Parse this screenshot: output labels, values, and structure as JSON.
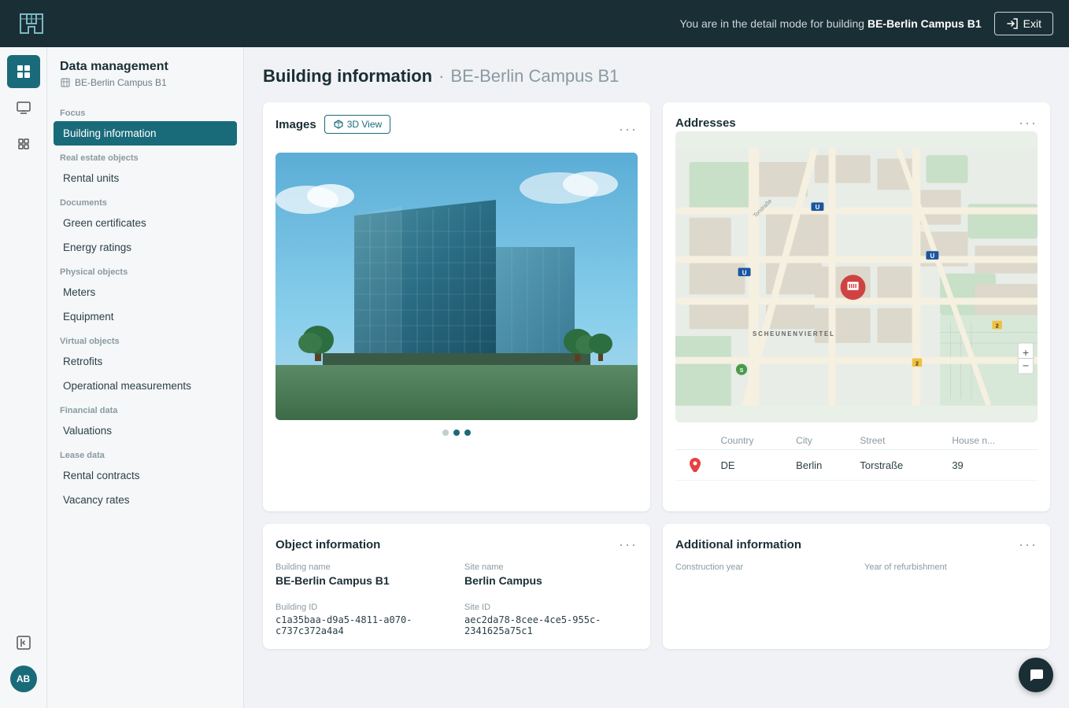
{
  "topbar": {
    "mode_text": "You are in the detail mode for building ",
    "building_name": "BE-Berlin Campus B1",
    "exit_label": "Exit"
  },
  "sidebar": {
    "title": "Data management",
    "subtitle": "BE-Berlin Campus B1",
    "focus_label": "Focus",
    "nav_items": [
      {
        "id": "building-information",
        "label": "Building information",
        "active": true,
        "section": null
      },
      {
        "id": "rental-units",
        "label": "Rental units",
        "active": false,
        "section": "Real estate objects"
      },
      {
        "id": "green-certificates",
        "label": "Green certificates",
        "active": false,
        "section": "Documents"
      },
      {
        "id": "energy-ratings",
        "label": "Energy ratings",
        "active": false,
        "section": null
      },
      {
        "id": "meters",
        "label": "Meters",
        "active": false,
        "section": "Physical objects"
      },
      {
        "id": "equipment",
        "label": "Equipment",
        "active": false,
        "section": null
      },
      {
        "id": "retrofits",
        "label": "Retrofits",
        "active": false,
        "section": "Virtual objects"
      },
      {
        "id": "operational-measurements",
        "label": "Operational measurements",
        "active": false,
        "section": null
      },
      {
        "id": "valuations",
        "label": "Valuations",
        "active": false,
        "section": "Financial data"
      },
      {
        "id": "rental-contracts",
        "label": "Rental contracts",
        "active": false,
        "section": "Lease data"
      },
      {
        "id": "vacancy-rates",
        "label": "Vacancy rates",
        "active": false,
        "section": null
      }
    ]
  },
  "page": {
    "title": "Building information",
    "separator": "·",
    "building_name": "BE-Berlin Campus B1"
  },
  "images_card": {
    "title": "Images",
    "view_3d_label": "3D View",
    "dots": [
      false,
      true,
      true
    ]
  },
  "addresses_card": {
    "title": "Addresses",
    "columns": [
      "Country",
      "City",
      "Street",
      "House n..."
    ],
    "rows": [
      {
        "country": "DE",
        "city": "Berlin",
        "street": "Torstraße",
        "house": "39"
      }
    ]
  },
  "object_info_card": {
    "title": "Object information",
    "fields": [
      {
        "label": "Building name",
        "value": "BE-Berlin Campus B1",
        "mono": false
      },
      {
        "label": "Site name",
        "value": "Berlin Campus",
        "mono": false
      },
      {
        "label": "Building ID",
        "value": "c1a35baa-d9a5-4811-a070-c737c372a4a4",
        "mono": true
      },
      {
        "label": "Site ID",
        "value": "aec2da78-8cee-4ce5-955c-2341625a75c1",
        "mono": true
      }
    ]
  },
  "additional_info_card": {
    "title": "Additional information",
    "fields": [
      {
        "label": "Construction year",
        "value": ""
      },
      {
        "label": "Year of refurbishment",
        "value": ""
      }
    ]
  },
  "avatar": {
    "initials": "AB"
  },
  "icons": {
    "table": "▦",
    "monitor": "⬛",
    "layers": "⬚",
    "list": "≡",
    "collapse": "◀"
  }
}
